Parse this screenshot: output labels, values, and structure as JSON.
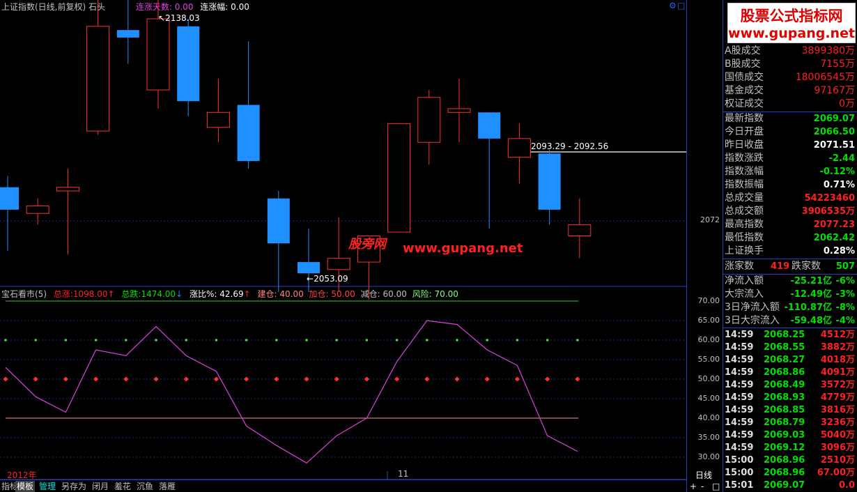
{
  "header": {
    "title": "上证指数(日线,前复权)",
    "pattern": "石头",
    "up_days_label": "连涨天数:",
    "up_days_value": "0.00",
    "up_range_label": "连涨幅:",
    "up_range_value": "0.00"
  },
  "main_chart": {
    "high_label": "2138.03",
    "low_label": "2053.09",
    "range_label": "2093.29 - 2092.56",
    "price_label": "2072",
    "candles": [
      {
        "o": 2081,
        "h": 2084,
        "l": 2064,
        "c": 2075
      },
      {
        "o": 2074,
        "h": 2078,
        "l": 2071,
        "c": 2076
      },
      {
        "o": 2080,
        "h": 2086,
        "l": 2063,
        "c": 2081
      },
      {
        "o": 2096,
        "h": 2133,
        "l": 2095,
        "c": 2124
      },
      {
        "o": 2123,
        "h": 2134,
        "l": 2114,
        "c": 2121
      },
      {
        "o": 2107,
        "h": 2133,
        "l": 2102,
        "c": 2126
      },
      {
        "o": 2124,
        "h": 2126,
        "l": 2100,
        "c": 2104
      },
      {
        "o": 2097,
        "h": 2110,
        "l": 2093,
        "c": 2101
      },
      {
        "o": 2103,
        "h": 2120,
        "l": 2086,
        "c": 2088
      },
      {
        "o": 2078,
        "h": 2080,
        "l": 2053,
        "c": 2066
      },
      {
        "o": 2061,
        "h": 2070,
        "l": 2053,
        "c": 2058
      },
      {
        "o": 2059,
        "h": 2073,
        "l": 2053,
        "c": 2062
      },
      {
        "o": 2061,
        "h": 2067,
        "l": 2051,
        "c": 2068
      },
      {
        "o": 2069,
        "h": 2098,
        "l": 2069,
        "c": 2098
      },
      {
        "o": 2093,
        "h": 2107,
        "l": 2087,
        "c": 2105
      },
      {
        "o": 2101,
        "h": 2110,
        "l": 2093,
        "c": 2102
      },
      {
        "o": 2101,
        "h": 2101,
        "l": 2070,
        "c": 2094
      },
      {
        "o": 2089,
        "h": 2098,
        "l": 2082,
        "c": 2094
      },
      {
        "o": 2090,
        "h": 2091,
        "l": 2071,
        "c": 2075
      },
      {
        "o": 2068,
        "h": 2078,
        "l": 2062,
        "c": 2071
      }
    ]
  },
  "indicator": {
    "name": "宝石看市(5)",
    "total_up_label": "总涨:",
    "total_up_value": "1098.00",
    "total_down_label": "总跌:",
    "total_down_value": "1474.00",
    "ratio_label": "涨比%:",
    "ratio_value": "42.69",
    "build_label": "建仓:",
    "build_value": "40.00",
    "add_label": "加仓:",
    "add_value": "50.00",
    "reduce_label": "减仓:",
    "reduce_value": "60.00",
    "risk_label": "风险:",
    "risk_value": "70.00",
    "line_values": [
      53,
      45.5,
      41.5,
      57.5,
      56,
      63.5,
      56,
      52,
      38,
      33,
      28.5,
      35.5,
      40,
      54.5,
      65,
      64,
      57.5,
      53.5,
      35.5,
      31.5
    ],
    "y_ticks": [
      "70.00",
      "65.00",
      "60.00",
      "55.00",
      "50.00",
      "45.00",
      "40.00",
      "35.00",
      "30.00"
    ]
  },
  "x_axis": {
    "year_label": "2012年",
    "month_label": "11"
  },
  "toolbar": {
    "items": [
      "指标",
      "模板",
      "管理",
      "另存为",
      "闭月",
      "羞花",
      "沉鱼",
      "落雁"
    ],
    "period_label": "日线",
    "plus": "+",
    "minus": "-",
    "expand": "□"
  },
  "logo": {
    "line1": "股票公式指标网",
    "line2": "www.gupang.net"
  },
  "watermark": {
    "text1": "股旁网",
    "text2": "www.gupang.net"
  },
  "quote_panel": {
    "volume_rows": [
      {
        "label": "A股成交",
        "value": "3899380万",
        "color": "#ff2020"
      },
      {
        "label": "B股成交",
        "value": "7155万",
        "color": "#ff2020"
      },
      {
        "label": "国债成交",
        "value": "18006545万",
        "color": "#ff2020"
      },
      {
        "label": "基金成交",
        "value": "97167万",
        "color": "#ff2020"
      },
      {
        "label": "权证成交",
        "value": "0万",
        "color": "#ff2020"
      }
    ],
    "index_rows": [
      {
        "label": "最新指数",
        "value": "2069.07",
        "color": "#00e000"
      },
      {
        "label": "今日开盘",
        "value": "2066.50",
        "color": "#00e000"
      },
      {
        "label": "昨日收盘",
        "value": "2071.51",
        "color": "#ffffff"
      },
      {
        "label": "指数涨跌",
        "value": "-2.44",
        "color": "#00e000"
      },
      {
        "label": "指数涨幅",
        "value": "-0.12%",
        "color": "#00e000"
      },
      {
        "label": "指数振幅",
        "value": "0.71%",
        "color": "#ffffff"
      },
      {
        "label": "总成交量",
        "value": "54223460",
        "color": "#ff2020"
      },
      {
        "label": "总成交额",
        "value": "3906535万",
        "color": "#ff2020"
      },
      {
        "label": "最高指数",
        "value": "2077.23",
        "color": "#ff2020"
      },
      {
        "label": "最低指数",
        "value": "2062.42",
        "color": "#00e000"
      },
      {
        "label": "上证换手",
        "value": "0.28%",
        "color": "#ffffff"
      }
    ],
    "breadth": {
      "up_label": "涨家数",
      "up_value": "419",
      "down_label": "跌家数",
      "down_value": "507"
    },
    "flow_rows": [
      {
        "label": "净流入额",
        "value": "-25.21亿",
        "pct": "-6%"
      },
      {
        "label": "大宗流入",
        "value": "-12.49亿",
        "pct": "-3%"
      },
      {
        "label": "3日净流入额",
        "value": "-110.87亿",
        "pct": "-8%"
      },
      {
        "label": "3日大宗流入",
        "value": "-59.48亿",
        "pct": "-4%"
      }
    ],
    "ticks": [
      {
        "time": "14:59",
        "price": "2068.25",
        "vol": "4512万"
      },
      {
        "time": "14:59",
        "price": "2068.55",
        "vol": "3882万"
      },
      {
        "time": "14:59",
        "price": "2068.27",
        "vol": "4018万"
      },
      {
        "time": "14:59",
        "price": "2068.86",
        "vol": "4091万"
      },
      {
        "time": "14:59",
        "price": "2068.49",
        "vol": "3572万"
      },
      {
        "time": "14:59",
        "price": "2068.93",
        "vol": "4779万"
      },
      {
        "time": "14:59",
        "price": "2068.85",
        "vol": "3816万"
      },
      {
        "time": "14:59",
        "price": "2068.79",
        "vol": "3236万"
      },
      {
        "time": "14:59",
        "price": "2069.03",
        "vol": "5040万"
      },
      {
        "time": "14:59",
        "price": "2069.12",
        "vol": "3096万"
      },
      {
        "time": "15:00",
        "price": "2068.96",
        "vol": "2510万"
      },
      {
        "time": "15:00",
        "price": "2068.96",
        "vol": "67.00万"
      },
      {
        "time": "15:01",
        "price": "2069.07",
        "vol": "0.0"
      }
    ]
  },
  "colors": {
    "up": "#ff3030",
    "down": "#1e90ff",
    "indicator_line": "#e040e0",
    "grid": "#1a2a80"
  }
}
